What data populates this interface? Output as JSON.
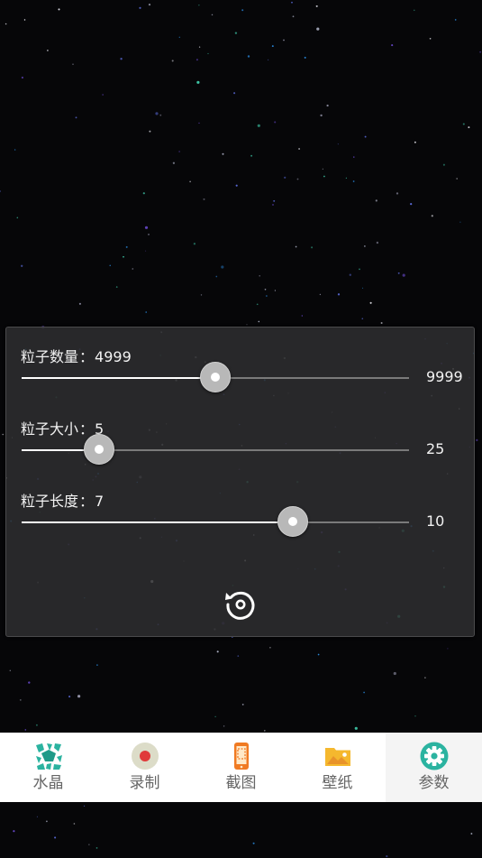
{
  "colors": {
    "accent_teal": "#2bb3a0",
    "record_red": "#e03a3a",
    "record_bg": "#dcdcc8",
    "phone_orange": "#f07a22",
    "folder_yellow": "#f5b82e",
    "nav_label": "#666666"
  },
  "settings": {
    "reset_icon": "reset-icon",
    "sliders": [
      {
        "label": "粒子数量",
        "separator": "：",
        "value": "4999",
        "max": "9999",
        "fraction": 0.5
      },
      {
        "label": "粒子大小",
        "separator": "：",
        "value": "5",
        "max": "25",
        "fraction": 0.2
      },
      {
        "label": "粒子长度",
        "separator": "：",
        "value": "7",
        "max": "10",
        "fraction": 0.7
      }
    ]
  },
  "nav": {
    "items": [
      {
        "label": "水晶",
        "icon": "crystal-icon",
        "active": false
      },
      {
        "label": "录制",
        "icon": "record-icon",
        "active": false
      },
      {
        "label": "截图",
        "icon": "screenshot-icon",
        "active": false
      },
      {
        "label": "壁纸",
        "icon": "wallpaper-icon",
        "active": false
      },
      {
        "label": "参数",
        "icon": "settings-gear-icon",
        "active": true
      }
    ]
  }
}
